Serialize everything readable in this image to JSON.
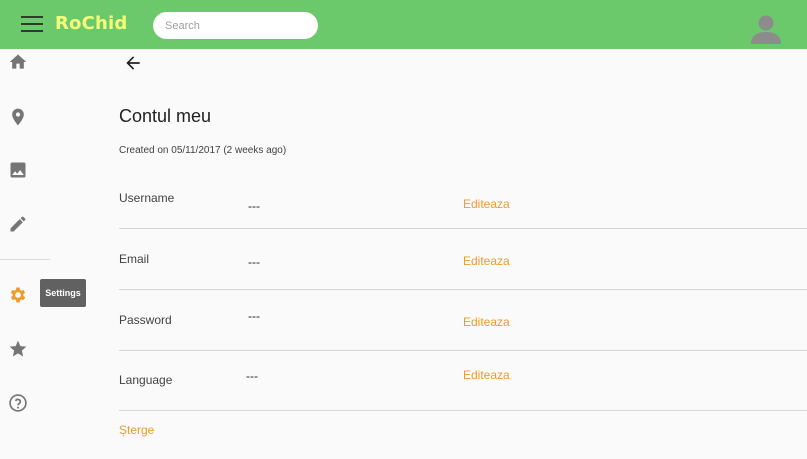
{
  "topbar": {
    "brand": "RoChid",
    "search_placeholder": "Search",
    "search_value": "",
    "background": "#6bc96c",
    "brand_color": "#f4ff7a",
    "menu_icon": "hamburger-menu-icon",
    "avatar_icon": "account-circle-icon"
  },
  "sidebar": {
    "items": [
      {
        "name": "home",
        "icon": "home-icon"
      },
      {
        "name": "location",
        "icon": "place-icon"
      },
      {
        "name": "images",
        "icon": "image-icon"
      },
      {
        "name": "edit",
        "icon": "pencil-icon"
      },
      {
        "name": "settings",
        "icon": "gear-icon",
        "active": true,
        "color": "#f09a2a"
      },
      {
        "name": "favorites",
        "icon": "star-icon"
      },
      {
        "name": "help",
        "icon": "help-circle-icon"
      }
    ],
    "tooltip": "Settings"
  },
  "main": {
    "back_icon": "arrow-left-icon",
    "title": "Contul meu",
    "created": "Created on 05/11/2017 (2 weeks ago)",
    "rows": [
      {
        "label": "Username",
        "value": "---",
        "action": "Editeaza"
      },
      {
        "label": "Email",
        "value": "---",
        "action": "Editeaza"
      },
      {
        "label": "Password",
        "value": "---",
        "action": "Editeaza"
      },
      {
        "label": "Language",
        "value": "---",
        "action": "Editeaza"
      }
    ],
    "delete_label": "Șterge",
    "accent": "#f09a2a"
  }
}
